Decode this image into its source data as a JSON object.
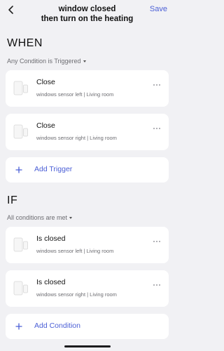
{
  "header": {
    "title": "window closed\nthen turn on the heating",
    "save_label": "Save"
  },
  "when": {
    "heading": "WHEN",
    "condition_mode": "Any Condition is Triggered",
    "triggers": [
      {
        "title": "Close",
        "subtitle": "windows sensor left | Living room"
      },
      {
        "title": "Close",
        "subtitle": "windows sensor right | Living room"
      }
    ],
    "add_label": "Add Trigger"
  },
  "if": {
    "heading": "IF",
    "condition_mode": "All conditions are met",
    "conditions": [
      {
        "title": "Is closed",
        "subtitle": "windows sensor left | Living room"
      },
      {
        "title": "Is closed",
        "subtitle": "windows sensor right | Living room"
      }
    ],
    "add_label": "Add Condition"
  },
  "colors": {
    "accent": "#4b5fd6",
    "background": "#f1f1f4",
    "card": "#ffffff"
  },
  "icons": {
    "back": "chevron-left-icon",
    "device": "window-sensor-icon",
    "more": "more-horizontal-icon",
    "add": "plus-circle-icon"
  }
}
